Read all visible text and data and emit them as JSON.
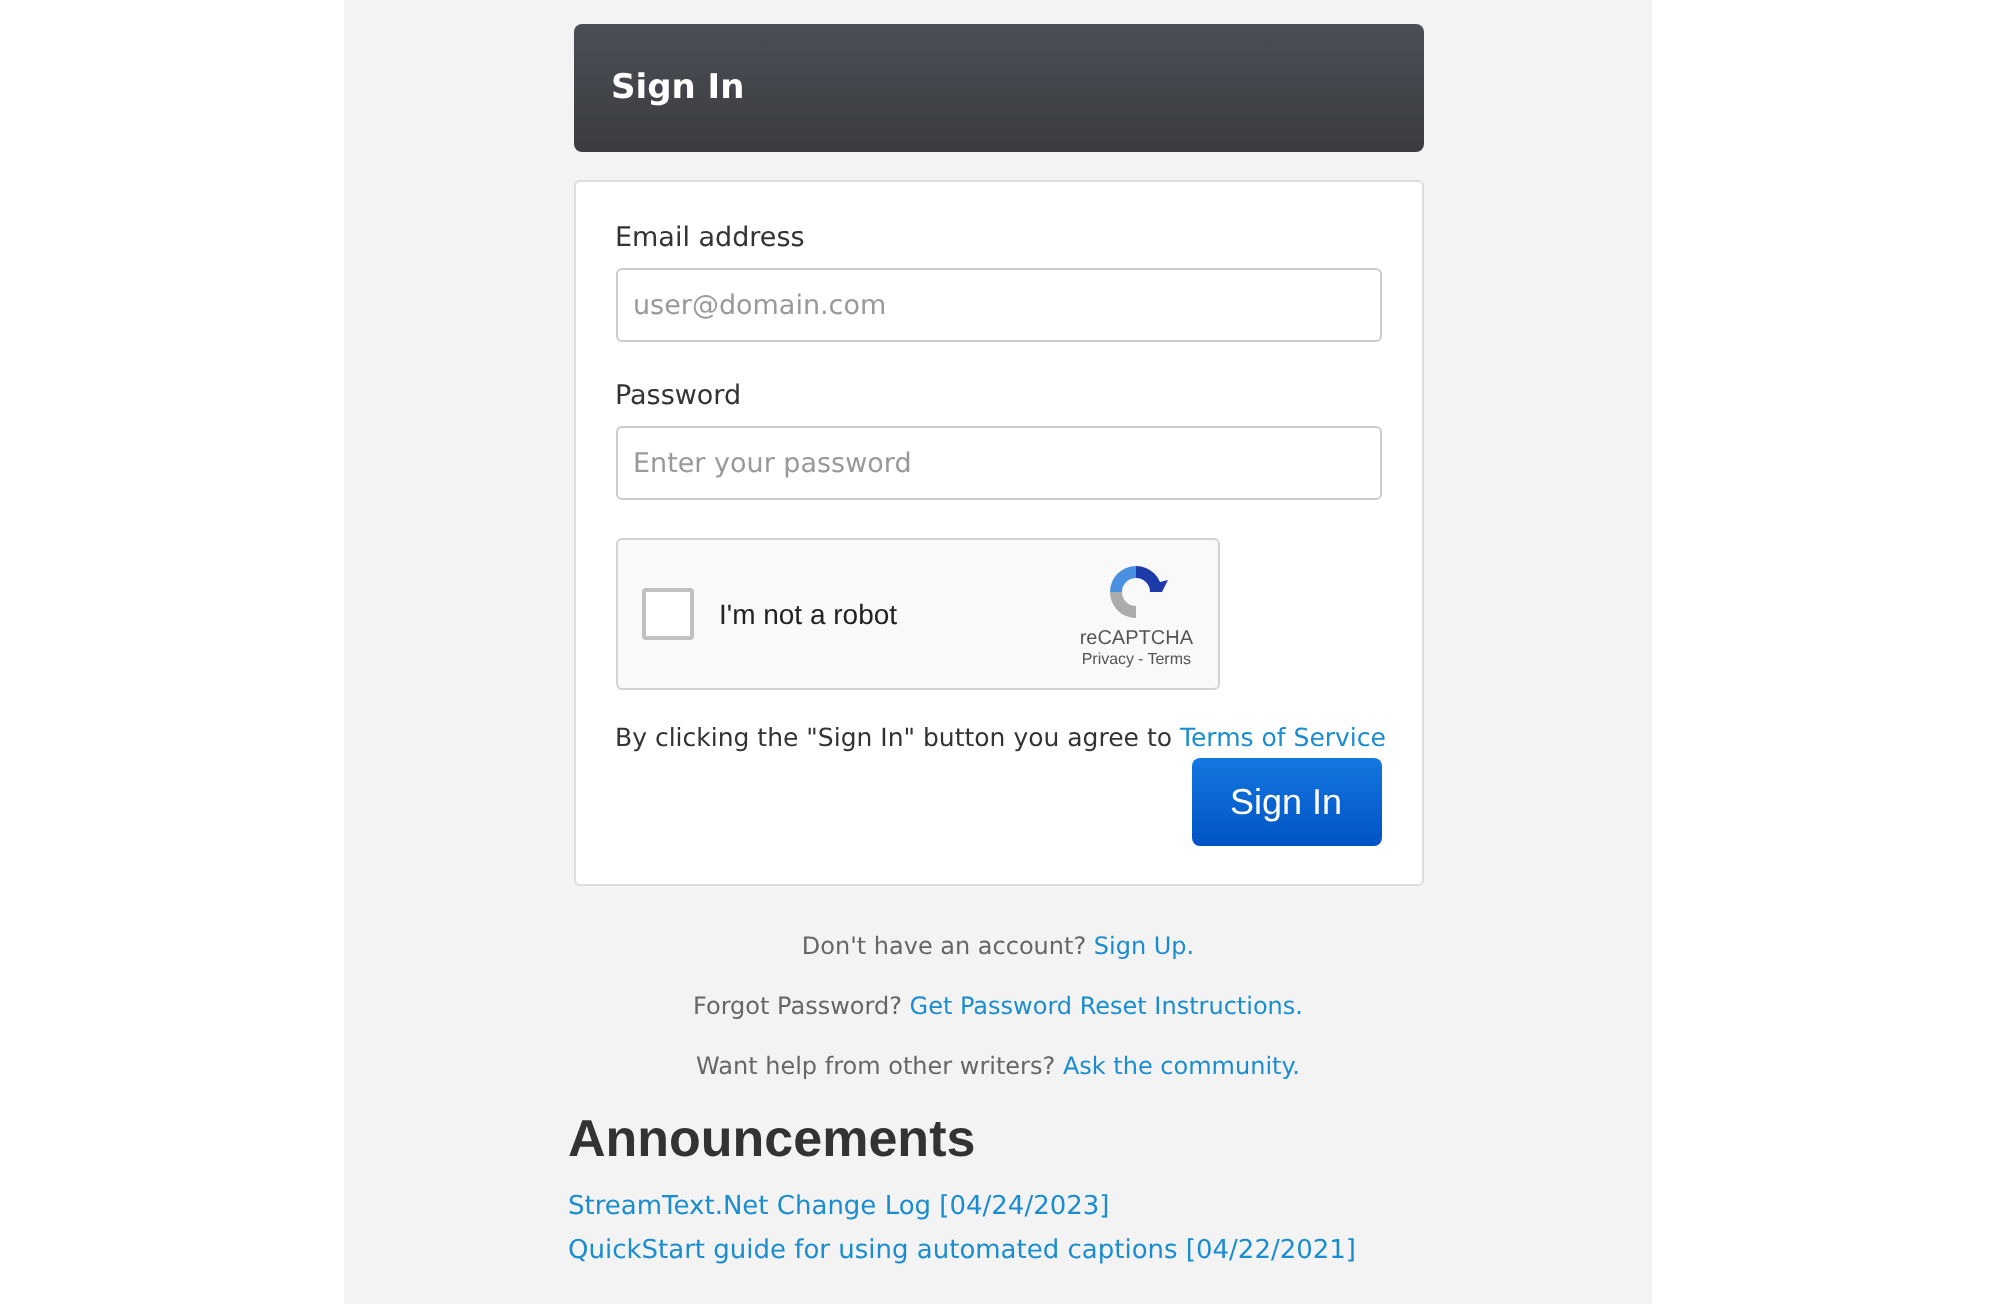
{
  "header": {
    "title": "Sign In"
  },
  "form": {
    "fields": [
      {
        "label": "Email address",
        "placeholder": "user@domain.com"
      },
      {
        "label": "Password",
        "placeholder": "Enter your password"
      }
    ],
    "captcha": {
      "label": "I'm not a robot",
      "checked": false,
      "brand": "reCAPTCHA",
      "privacy": "Privacy",
      "separator": "-",
      "terms": "Terms"
    },
    "agreement": {
      "text": "By clicking the \"Sign In\" button you agree to",
      "link": "Terms of Service"
    },
    "submit": "Sign In"
  },
  "help_links": [
    {
      "text": "Don't have an account?",
      "link": "Sign Up."
    },
    {
      "text": "Forgot Password?",
      "link": "Get Password Reset Instructions."
    },
    {
      "text": "Want help from other writers?",
      "link": "Ask the community."
    }
  ],
  "announcements": {
    "title": "Announcements",
    "items": [
      "StreamText.Net Change Log [04/24/2023]",
      "QuickStart guide for using automated captions [04/22/2021]"
    ]
  }
}
